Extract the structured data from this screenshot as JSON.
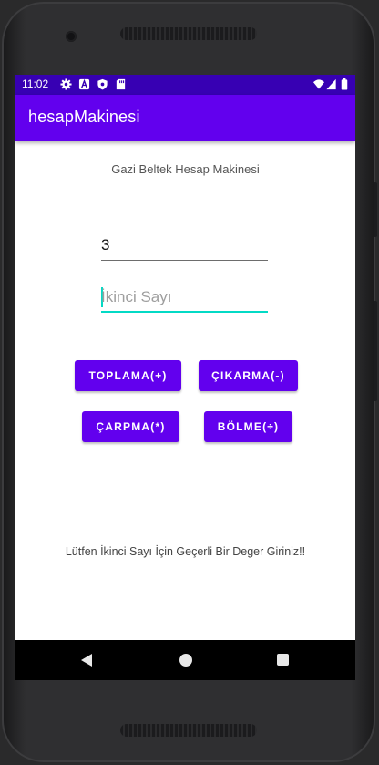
{
  "device": {
    "status_bar": {
      "time": "11:02",
      "left_icons": [
        "gear-icon",
        "a-badge-icon",
        "shield-icon",
        "sd-card-icon"
      ],
      "right_icons": [
        "wifi-icon",
        "signal-icon",
        "battery-icon"
      ],
      "color": "#3700b3"
    },
    "nav_bar": {
      "buttons": [
        "back-icon",
        "home-icon",
        "recents-icon"
      ]
    }
  },
  "app": {
    "title": "hesapMakinesi",
    "primary_color": "#6200ee",
    "accent_color": "#03dac5"
  },
  "main": {
    "subtitle": "Gazi Beltek Hesap Makinesi",
    "first_input": {
      "value": "3"
    },
    "second_input": {
      "value": "",
      "placeholder": "İkinci Sayı"
    },
    "buttons": {
      "add": "TOPLAMA(+)",
      "subtract": "ÇIKARMA(-)",
      "multiply": "ÇARPMA(*)",
      "divide": "BÖLME(÷)"
    },
    "message": "Lütfen İkinci Sayı İçin Geçerli Bir Deger Giriniz!!"
  }
}
